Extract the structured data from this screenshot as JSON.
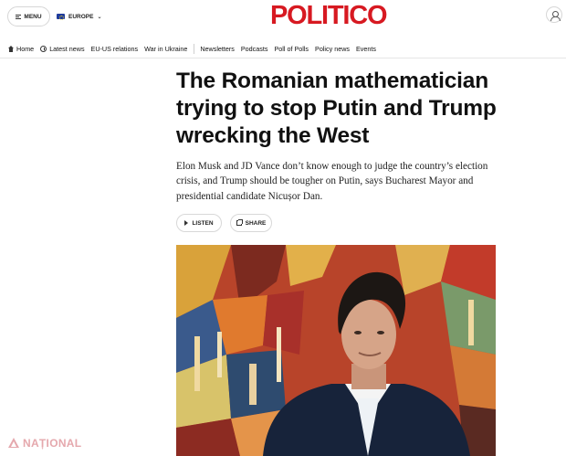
{
  "header": {
    "menu_label": "MENU",
    "edition_label": "EUROPE",
    "logo": "POLITICO",
    "brand_color": "#d71921"
  },
  "nav": {
    "items": [
      {
        "label": "Home",
        "icon": "home-icon"
      },
      {
        "label": "Latest news",
        "icon": "clock-icon"
      },
      {
        "label": "EU-US relations"
      },
      {
        "label": "War in Ukraine"
      },
      {
        "label": "Newsletters"
      },
      {
        "label": "Podcasts"
      },
      {
        "label": "Poll of Polls"
      },
      {
        "label": "Policy news"
      },
      {
        "label": "Events"
      }
    ]
  },
  "article": {
    "headline": "The Romanian mathematician trying to stop Putin and Trump wrecking the West",
    "dek": "Elon Musk and JD Vance don’t know enough to judge the country’s election crisis, and Trump should be tougher on Putin, says Bucharest Mayor and presidential candidate Nicușor Dan.",
    "listen_label": "LISTEN",
    "share_label": "SHARE"
  },
  "watermark": {
    "text": "NAȚIONAL",
    "color": "#e5a8ad"
  }
}
